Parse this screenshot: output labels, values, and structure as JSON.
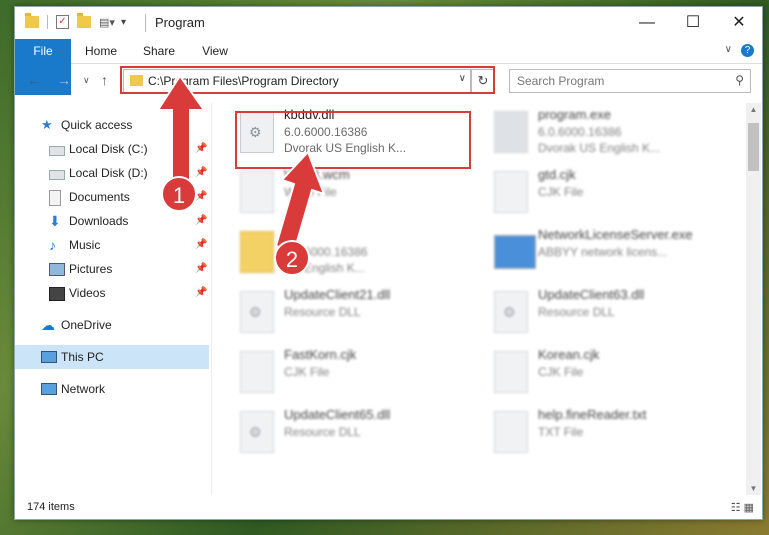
{
  "window": {
    "title": "Program"
  },
  "ribbon": {
    "tabs": [
      "File",
      "Home",
      "Share",
      "View"
    ]
  },
  "nav": {
    "address": "C:\\Program Files\\Program Directory",
    "search_placeholder": "Search Program"
  },
  "sidebar": {
    "items": [
      {
        "label": "Quick access",
        "icon": "star-icon"
      },
      {
        "label": "Local Disk (C:)",
        "icon": "drive-icon",
        "pinned": true
      },
      {
        "label": "Local Disk (D:)",
        "icon": "drive-icon",
        "pinned": true
      },
      {
        "label": "Documents",
        "icon": "documents-icon",
        "pinned": true
      },
      {
        "label": "Downloads",
        "icon": "download-icon",
        "pinned": true
      },
      {
        "label": "Music",
        "icon": "music-icon",
        "pinned": true
      },
      {
        "label": "Pictures",
        "icon": "pictures-icon",
        "pinned": true
      },
      {
        "label": "Videos",
        "icon": "videos-icon",
        "pinned": true
      },
      {
        "label": "OneDrive",
        "icon": "cloud-icon"
      },
      {
        "label": "This PC",
        "icon": "computer-icon",
        "selected": true
      },
      {
        "label": "Network",
        "icon": "network-icon"
      }
    ]
  },
  "files": [
    {
      "name": "kbddv.dll",
      "line1": "6.0.6000.16386",
      "line2": "Dvorak US English K..."
    },
    {
      "name": "program.exe",
      "line1": "6.0.6000.16386",
      "line2": "Dvorak US English K..."
    },
    {
      "name": "WP14.wcm",
      "line1": "WCM File",
      "line2": ""
    },
    {
      "name": "gtd.cjk",
      "line1": "CJK File",
      "line2": ""
    },
    {
      "name": "",
      "line1": "6.0.6000.16386",
      "line2": "US English K..."
    },
    {
      "name": "NetworkLicenseServer.exe",
      "line1": "ABBYY network licens...",
      "line2": ""
    },
    {
      "name": "UpdateClient21.dll",
      "line1": "Resource DLL",
      "line2": ""
    },
    {
      "name": "UpdateClient63.dll",
      "line1": "Resource DLL",
      "line2": ""
    },
    {
      "name": "FastKorn.cjk",
      "line1": "CJK File",
      "line2": ""
    },
    {
      "name": "Korean.cjk",
      "line1": "CJK File",
      "line2": ""
    },
    {
      "name": "UpdateClient65.dll",
      "line1": "Resource DLL",
      "line2": ""
    },
    {
      "name": "help.fineReader.txt",
      "line1": "TXT File",
      "line2": ""
    }
  ],
  "status": {
    "count": "174 items"
  },
  "annotations": {
    "step1": "1",
    "step2": "2"
  }
}
